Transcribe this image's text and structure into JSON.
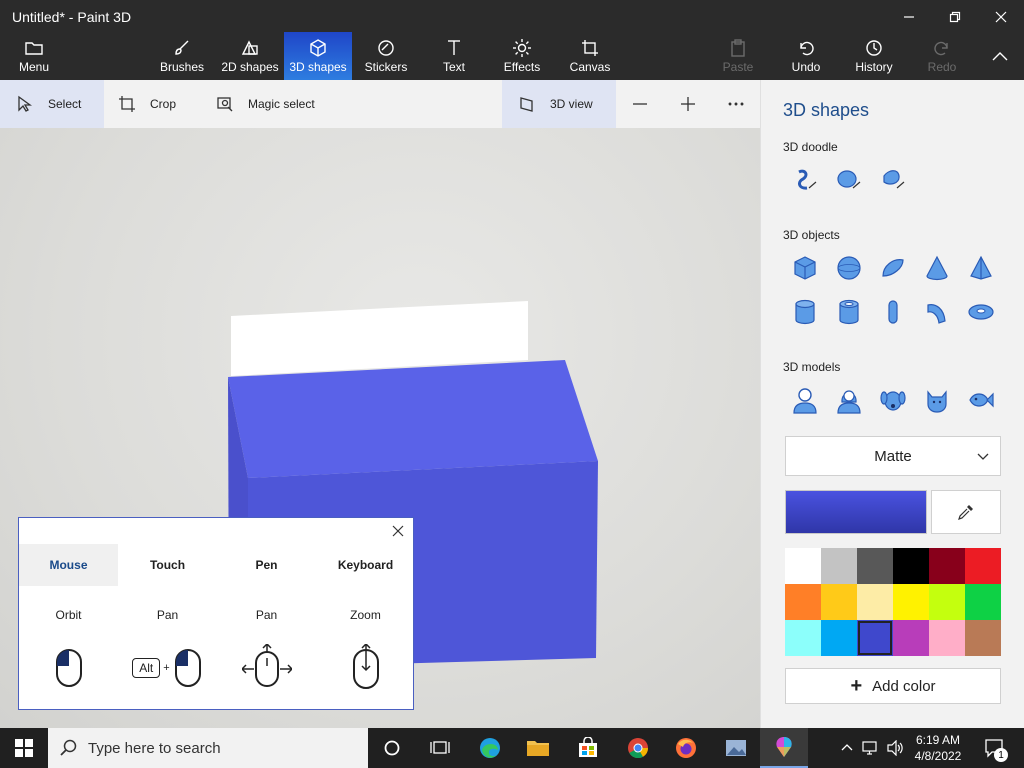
{
  "window": {
    "title": "Untitled* - Paint 3D"
  },
  "ribbon": {
    "menu": "Menu",
    "brushes": "Brushes",
    "shapes2d": "2D shapes",
    "shapes3d": "3D shapes",
    "stickers": "Stickers",
    "text": "Text",
    "effects": "Effects",
    "canvas": "Canvas",
    "paste": "Paste",
    "undo": "Undo",
    "history": "History",
    "redo": "Redo",
    "active": "3D shapes"
  },
  "toolbar": {
    "select": "Select",
    "crop": "Crop",
    "magic_select": "Magic select",
    "view3d": "3D view"
  },
  "panel": {
    "title": "3D shapes",
    "doodle_label": "3D doodle",
    "objects_label": "3D objects",
    "models_label": "3D models",
    "material": "Matte",
    "add_color": "Add color",
    "selected_color": "#3b46c9",
    "palette": [
      "#ffffff",
      "#c3c3c3",
      "#585858",
      "#000000",
      "#88001b",
      "#ec1c24",
      "#ff7f27",
      "#ffca18",
      "#fdeca6",
      "#fff200",
      "#c4ff0e",
      "#0ed145",
      "#8cfffb",
      "#00a8f3",
      "#3f48cc",
      "#b83dba",
      "#ffaec8",
      "#b97a56"
    ],
    "selected_swatch_index": 14
  },
  "help": {
    "tabs": [
      "Mouse",
      "Touch",
      "Pen",
      "Keyboard"
    ],
    "active_tab": "Mouse",
    "actions": [
      "Orbit",
      "Pan",
      "Pan",
      "Zoom"
    ],
    "alt_key": "Alt",
    "plus": "+"
  },
  "taskbar": {
    "search_placeholder": "Type here to search",
    "time": "6:19 AM",
    "date": "4/8/2022",
    "notifications": "1"
  },
  "colors": {
    "accent": "#2e6fd9",
    "box": "#5158e6"
  }
}
